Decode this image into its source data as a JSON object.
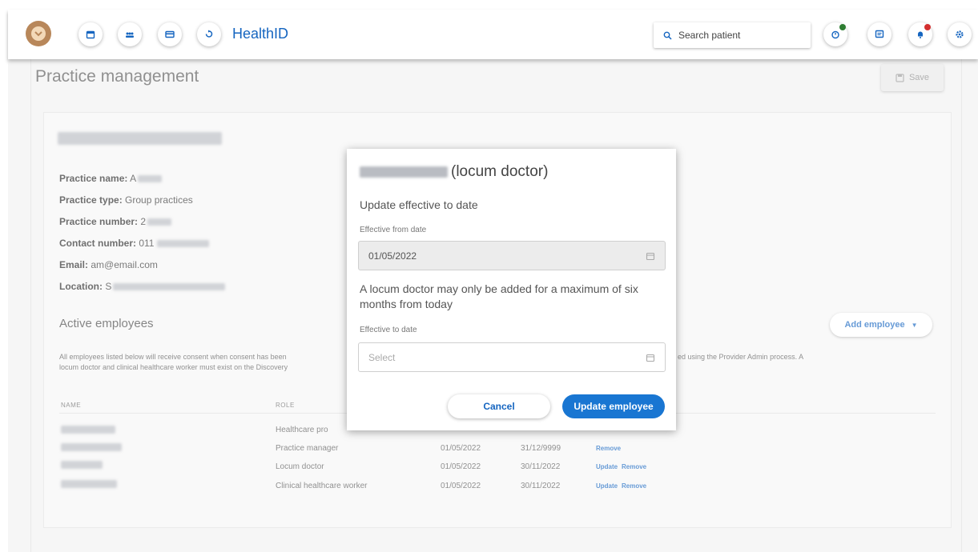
{
  "header": {
    "app_title": "HealthID",
    "search_placeholder": "Search patient",
    "nav_icons": [
      "calendar-icon",
      "people-icon",
      "card-icon",
      "refresh-icon"
    ],
    "right_icons": [
      "timer-icon",
      "message-icon",
      "bell-icon",
      "settings-icon"
    ]
  },
  "page": {
    "title": "Practice management",
    "save_label": "Save",
    "practice_heading_redacted": true,
    "info": [
      {
        "label": "Practice name:",
        "value": "A"
      },
      {
        "label": "Practice type:",
        "value": "Group practices"
      },
      {
        "label": "Practice number:",
        "value": "2"
      },
      {
        "label": "Contact number:",
        "value": "011"
      },
      {
        "label": "Email:",
        "value": "am@email.com"
      },
      {
        "label": "Location:",
        "value": "S"
      }
    ],
    "active_employees_title": "Active employees",
    "add_employee_label": "Add employee",
    "description_left": "All employees listed below will receive consent when consent has been",
    "description_left_2": "locum doctor and clinical healthcare worker must exist on the Discovery",
    "description_right": "ed using the Provider Admin process. A",
    "table": {
      "headers": [
        "NAME",
        "ROLE"
      ],
      "rows": [
        {
          "role": "Healthcare pro",
          "from": "",
          "to": "",
          "actions": []
        },
        {
          "role": "Practice manager",
          "from": "01/05/2022",
          "to": "31/12/9999",
          "actions": [
            "Remove"
          ]
        },
        {
          "role": "Locum doctor",
          "from": "01/05/2022",
          "to": "30/11/2022",
          "actions": [
            "Update",
            "Remove"
          ]
        },
        {
          "role": "Clinical healthcare worker",
          "from": "01/05/2022",
          "to": "30/11/2022",
          "actions": [
            "Update",
            "Remove"
          ]
        }
      ]
    }
  },
  "modal": {
    "title_suffix": "(locum doctor)",
    "subtitle": "Update effective to date",
    "from_label": "Effective from date",
    "from_value": "01/05/2022",
    "note": "A locum doctor may only be added for a maximum of six months from today",
    "to_label": "Effective to date",
    "to_placeholder": "Select",
    "cancel_label": "Cancel",
    "update_label": "Update employee"
  },
  "colors": {
    "accent": "#1976d2",
    "link": "#1565c0",
    "logo": "#b8875a",
    "status_green": "#2e7d32",
    "status_red": "#d32f2f"
  }
}
